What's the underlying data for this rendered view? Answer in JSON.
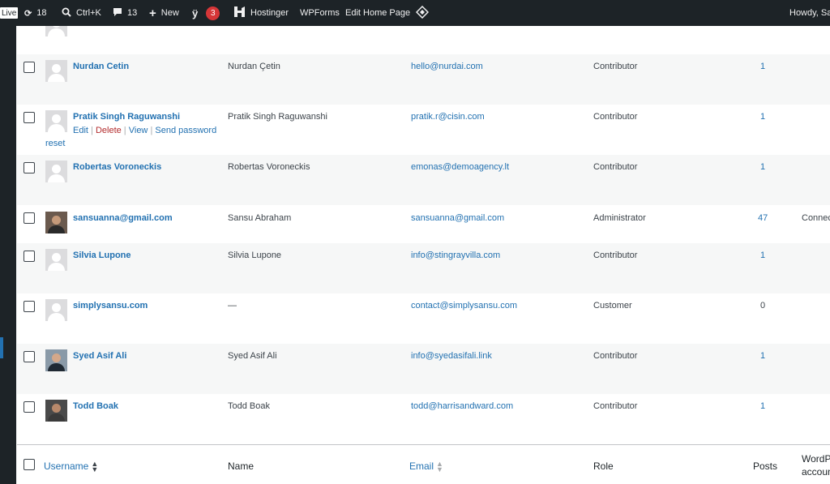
{
  "adminbar": {
    "live": "Live",
    "updates_count": "18",
    "search_shortcut": "Ctrl+K",
    "comments_count": "13",
    "new_label": "New",
    "yoast_count": "3",
    "hostinger_label": "Hostinger",
    "wpforms_label": "WPForms",
    "edit_page_label": "Edit Home Page",
    "howdy": "Howdy, Sa"
  },
  "users": [
    {
      "username": "Nurdan Cetin",
      "name": "Nurdan Çetin",
      "email": "hello@nurdai.com",
      "role": "Contributor",
      "posts": "1",
      "extra": ""
    },
    {
      "username": "Pratik Singh Raguwanshi",
      "name": "Pratik Singh Raguwanshi",
      "email": "pratik.r@cisin.com",
      "role": "Contributor",
      "posts": "1",
      "extra": ""
    },
    {
      "username": "Robertas Voroneckis",
      "name": "Robertas Voroneckis",
      "email": "emonas@demoagency.lt",
      "role": "Contributor",
      "posts": "1",
      "extra": ""
    },
    {
      "username": "sansuanna@gmail.com",
      "name": "Sansu Abraham",
      "email": "sansuanna@gmail.com",
      "role": "Administrator",
      "posts": "47",
      "extra": "Connec"
    },
    {
      "username": "Silvia Lupone",
      "name": "Silvia Lupone",
      "email": "info@stingrayvilla.com",
      "role": "Contributor",
      "posts": "1",
      "extra": ""
    },
    {
      "username": "simplysansu.com",
      "name": "—",
      "email": "contact@simplysansu.com",
      "role": "Customer",
      "posts": "0",
      "extra": ""
    },
    {
      "username": "Syed Asif Ali",
      "name": "Syed Asif Ali",
      "email": "info@syedasifali.link",
      "role": "Contributor",
      "posts": "1",
      "extra": ""
    },
    {
      "username": "Todd Boak",
      "name": "Todd Boak",
      "email": "todd@harrisandward.com",
      "role": "Contributor",
      "posts": "1",
      "extra": ""
    }
  ],
  "row_actions": {
    "edit": "Edit",
    "delete": "Delete",
    "view": "View",
    "send_password": "Send password",
    "reset": "reset",
    "sep": " | "
  },
  "columns": {
    "username": "Username",
    "name": "Name",
    "email": "Email",
    "role": "Role",
    "posts": "Posts",
    "extra_line1": "WordPr",
    "extra_line2": "accoun"
  },
  "icons": {
    "sort": "sort-arrows-icon",
    "updates": "refresh-icon",
    "search": "search-icon",
    "comments": "comment-icon",
    "new": "plus-icon",
    "yoast": "yoast-icon",
    "hostinger": "hostinger-icon",
    "diamond": "diamond-icon"
  }
}
